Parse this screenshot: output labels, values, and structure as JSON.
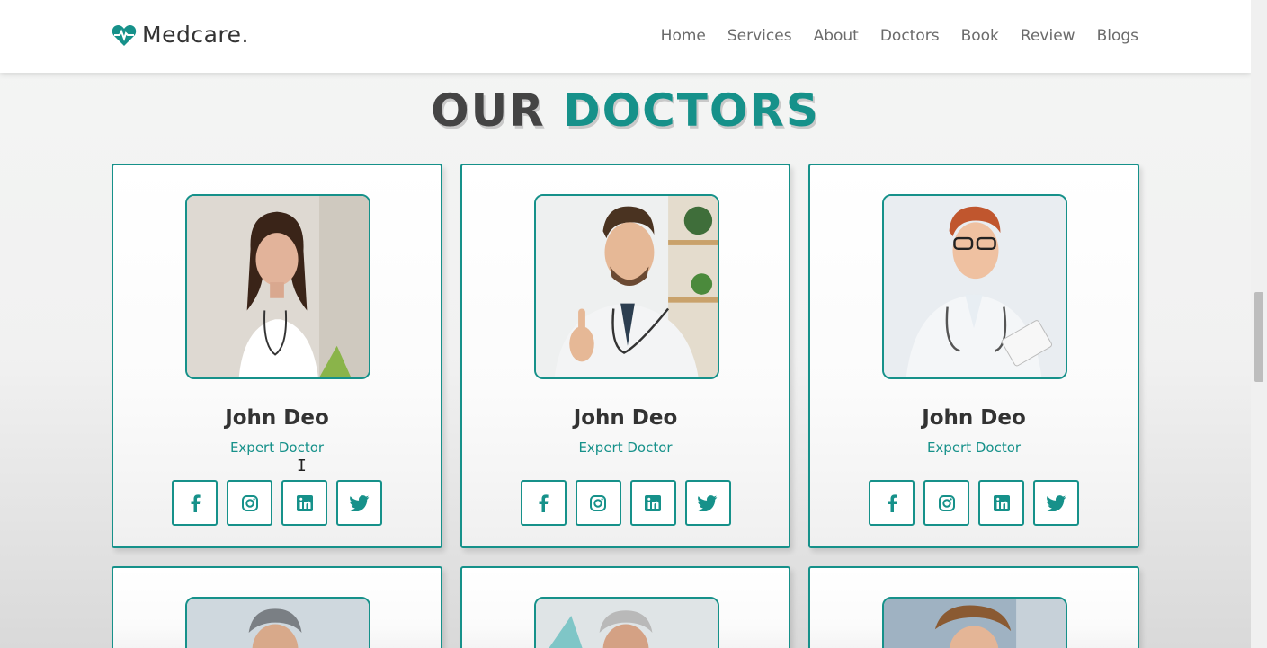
{
  "header": {
    "logo_text": "Medcare.",
    "logo_icon": "heart-pulse-icon",
    "nav": [
      "Home",
      "Services",
      "About",
      "Doctors",
      "Book",
      "Review",
      "Blogs"
    ]
  },
  "section": {
    "title_part1": "OUR",
    "title_part2": "DOCTORS"
  },
  "colors": {
    "accent": "#16918a",
    "text_dark": "#333333"
  },
  "doctors": [
    {
      "name": "John Deo",
      "role": "Expert Doctor",
      "socials": [
        "facebook-icon",
        "instagram-icon",
        "linkedin-icon",
        "twitter-icon"
      ]
    },
    {
      "name": "John Deo",
      "role": "Expert Doctor",
      "socials": [
        "facebook-icon",
        "instagram-icon",
        "linkedin-icon",
        "twitter-icon"
      ]
    },
    {
      "name": "John Deo",
      "role": "Expert Doctor",
      "socials": [
        "facebook-icon",
        "instagram-icon",
        "linkedin-icon",
        "twitter-icon"
      ]
    }
  ]
}
